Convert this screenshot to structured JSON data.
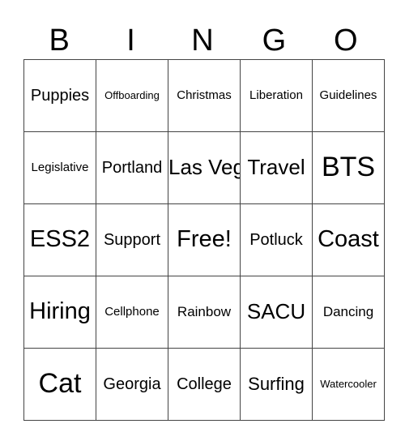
{
  "header": {
    "letters": [
      "B",
      "I",
      "N",
      "G",
      "O"
    ]
  },
  "board": {
    "rows": [
      [
        "Puppies",
        "Offboarding",
        "Christmas",
        "Liberation",
        "Guidelines"
      ],
      [
        "Legislative",
        "Portland",
        "Las Vegas",
        "Travel",
        "BTS"
      ],
      [
        "ESS2",
        "Support",
        "Free!",
        "Potluck",
        "Coast"
      ],
      [
        "Hiring",
        "Cellphone",
        "Rainbow",
        "SACU",
        "Dancing"
      ],
      [
        "Cat",
        "Georgia",
        "College",
        "Surfing",
        "Watercooler"
      ]
    ],
    "free_space": "Free!"
  }
}
